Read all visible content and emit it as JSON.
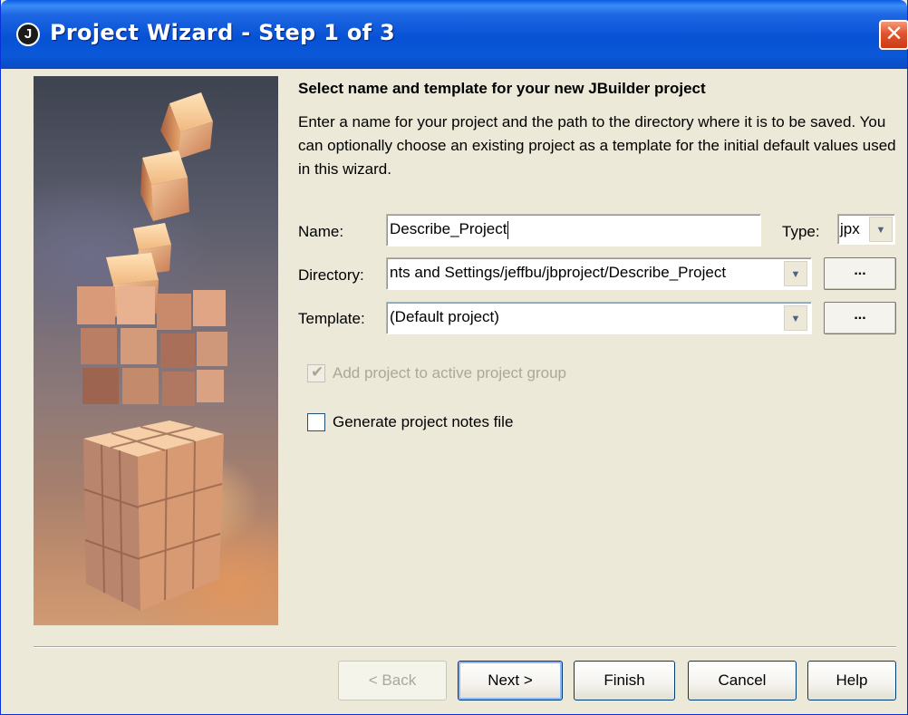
{
  "window": {
    "title": "Project Wizard - Step 1 of 3",
    "icon_letter": "J",
    "close_glyph": "✕"
  },
  "main": {
    "heading": "Select name and template for your new JBuilder project",
    "description": "Enter a name for your project and the path to the directory where it is to be saved. You can optionally choose an existing project as a template for the initial default values used in this wizard."
  },
  "form": {
    "name_label": "Name:",
    "name_value": "Describe_Project",
    "type_label": "Type:",
    "type_value": "jpx",
    "directory_label": "Directory:",
    "directory_value": "nts and Settings/jeffbu/jbproject/Describe_Project",
    "template_label": "Template:",
    "template_value": "(Default project)",
    "browse_glyph": "...",
    "dropdown_glyph": "▼"
  },
  "options": {
    "add_to_group_label": "Add project to active project group",
    "add_to_group_checked": true,
    "add_to_group_enabled": false,
    "notes_label": "Generate project notes file",
    "notes_checked": false,
    "check_glyph": "✔"
  },
  "buttons": {
    "back": "< Back",
    "next": "Next >",
    "finish": "Finish",
    "cancel": "Cancel",
    "help": "Help"
  },
  "colors": {
    "titlebar": "#0751d4",
    "dialog_bg": "#ece9d8",
    "close_button": "#e0552f",
    "disabled_text": "#aca899"
  }
}
